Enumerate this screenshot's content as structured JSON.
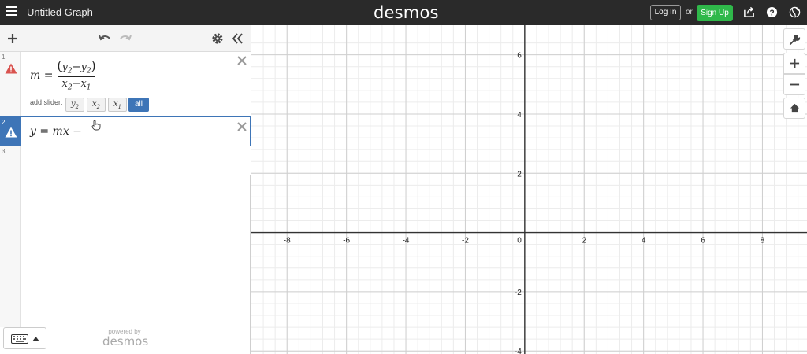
{
  "app": {
    "title": "Untitled Graph",
    "brand": "desmos",
    "login_label": "Log In",
    "or_label": "or",
    "signup_label": "Sign Up"
  },
  "expressions": [
    {
      "index": "1",
      "lhs": "m =",
      "numerator_open": "(",
      "y2a": "y",
      "sub_2a": "2",
      "minus_a": "−",
      "y2b": "y",
      "sub_2b": "2",
      "numerator_close": ")",
      "den_x2": "x",
      "sub_2c": "2",
      "minus_b": "−",
      "den_x1": "x",
      "sub_1": "1",
      "status": "error"
    },
    {
      "index": "2",
      "text": "y = mx −",
      "status": "error"
    },
    {
      "index": "3",
      "text": ""
    }
  ],
  "slider": {
    "label": "add slider:",
    "chips": [
      "y2",
      "x2",
      "x1",
      "all"
    ],
    "chip_y": "y",
    "chip_y_sub": "2",
    "chip_x2": "x",
    "chip_x2_sub": "2",
    "chip_x1": "x",
    "chip_x1_sub": "1",
    "chip_all": "all"
  },
  "powered": {
    "line1": "powered by",
    "line2": "desmos"
  },
  "graph_axes": {
    "x_ticks": [
      "-8",
      "-6",
      "-4",
      "-2",
      "0",
      "2",
      "4",
      "6",
      "8"
    ],
    "y_ticks": [
      "6",
      "4",
      "2",
      "-2",
      "-4"
    ],
    "x_range": [
      -9.2,
      9.5
    ],
    "y_range": [
      -4.1,
      7.0
    ],
    "grid": true
  },
  "colors": {
    "topbar": "#2a2a2a",
    "signup": "#2fb84a",
    "selected": "#3e75b7",
    "warning": "#d9534f"
  },
  "icons": [
    "menu-icon",
    "share-icon",
    "help-icon",
    "globe-icon",
    "plus-icon",
    "undo-icon",
    "redo-icon",
    "gear-icon",
    "collapse-icon",
    "warning-icon",
    "close-icon",
    "keyboard-icon",
    "wrench-icon",
    "zoom-in-icon",
    "zoom-out-icon",
    "home-icon"
  ]
}
